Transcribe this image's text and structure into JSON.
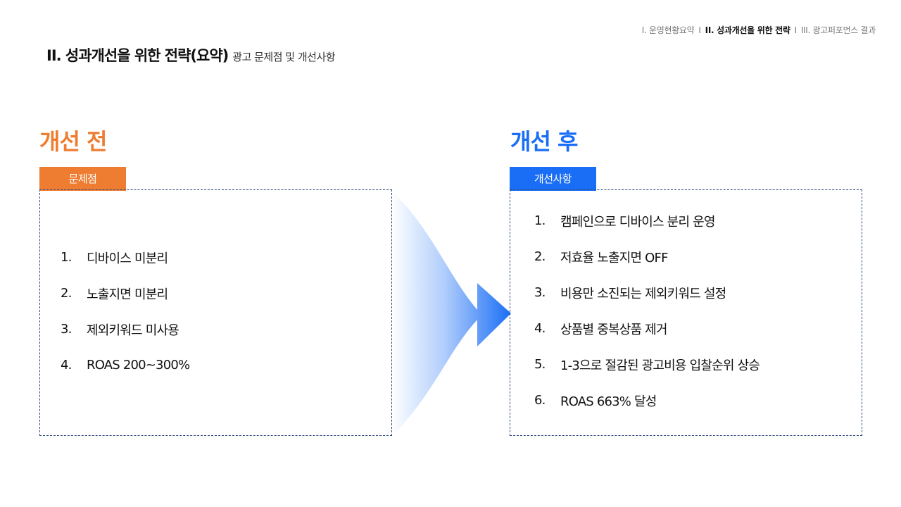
{
  "nav": {
    "item1": "I. 운영현황요약",
    "sep1": "I",
    "item2": "II. 성과개선을 위한 전략",
    "sep2": "I",
    "item3": "III. 광고퍼포먼스 결과"
  },
  "header": {
    "title": "II. 성과개선을 위한 전략(요약)",
    "subtitle": "광고 문제점 및 개선사항"
  },
  "before": {
    "heading": "개선 전",
    "tag": "문제점",
    "items": [
      {
        "num": "1.",
        "text": "디바이스 미분리"
      },
      {
        "num": "2.",
        "text": "노출지면 미분리"
      },
      {
        "num": "3.",
        "text": "제외키워드 미사용"
      },
      {
        "num": "4.",
        "text": "ROAS 200~300%"
      }
    ]
  },
  "after": {
    "heading": "개선 후",
    "tag": "개선사항",
    "items": [
      {
        "num": "1.",
        "text": "캠페인으로 디바이스 분리 운영"
      },
      {
        "num": "2.",
        "text": "저효율 노출지면 OFF"
      },
      {
        "num": "3.",
        "text": "비용만 소진되는 제외키워드 설정"
      },
      {
        "num": "4.",
        "text": "상품별 중복상품 제거"
      },
      {
        "num": "5.",
        "text": "1-3으로 절감된 광고비용 입찰순위 상승"
      },
      {
        "num": "6.",
        "text": "ROAS 663% 달성"
      }
    ]
  },
  "colors": {
    "before_accent": "#ee7d31",
    "after_accent": "#1a6ef5",
    "box_border": "#2d4a7a"
  }
}
